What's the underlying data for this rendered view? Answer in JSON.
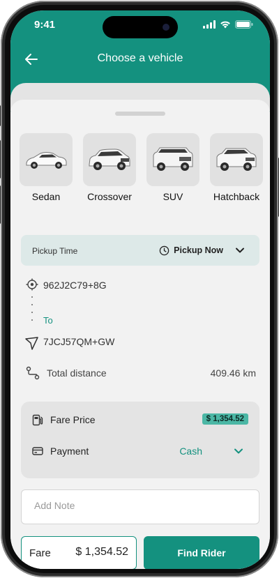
{
  "status_bar": {
    "time": "9:41"
  },
  "header": {
    "title": "Choose a vehicle"
  },
  "vehicles": [
    {
      "label": "Sedan"
    },
    {
      "label": "Crossover"
    },
    {
      "label": "SUV"
    },
    {
      "label": "Hatchback"
    }
  ],
  "pickup": {
    "label": "Pickup Time",
    "value": "Pickup Now"
  },
  "route": {
    "origin": "962J2C79+8G",
    "to_label": "To",
    "destination": "7JCJ57QM+GW"
  },
  "distance": {
    "label": "Total distance",
    "value": "409.46 km"
  },
  "fare_card": {
    "fare_label": "Fare Price",
    "fare_value": "$ 1,354.52",
    "payment_label": "Payment",
    "payment_value": "Cash"
  },
  "note": {
    "placeholder": "Add Note"
  },
  "footer": {
    "fare_label": "Fare",
    "fare_value": "$ 1,354.52",
    "button_label": "Find Rider"
  },
  "colors": {
    "accent": "#14917f",
    "badge": "#4bb7a5",
    "pickup_bg": "#dde9e8"
  }
}
